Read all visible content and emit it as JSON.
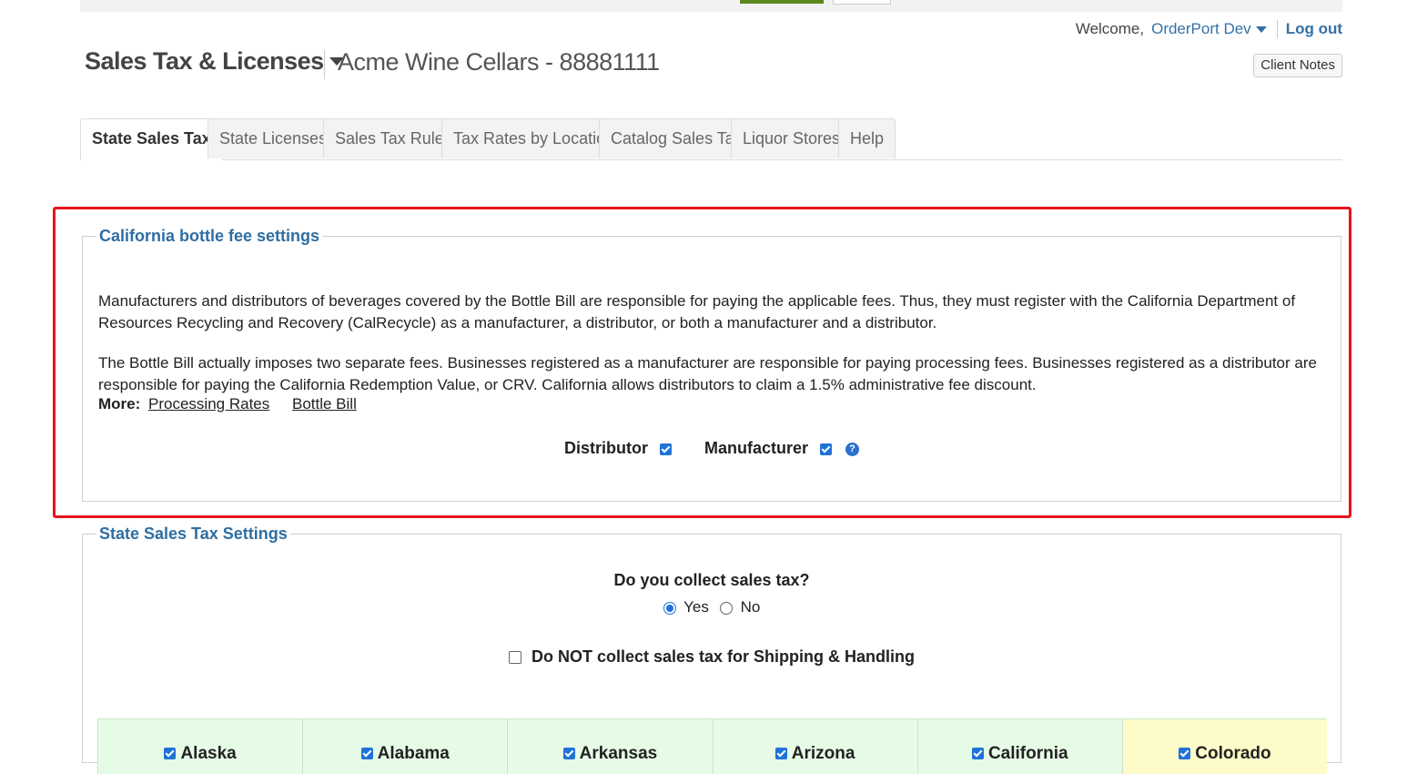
{
  "header": {
    "welcome": "Welcome,",
    "user": "OrderPort Dev",
    "logout": "Log out",
    "client_notes": "Client Notes",
    "section_title": "Sales Tax & Licenses",
    "company": "Acme Wine Cellars - 88881111"
  },
  "tabs": [
    {
      "label": "State Sales Tax",
      "active": true
    },
    {
      "label": "State Licenses"
    },
    {
      "label": "Sales Tax Rules"
    },
    {
      "label": "Tax Rates by Location"
    },
    {
      "label": "Catalog Sales Tax"
    },
    {
      "label": "Liquor Stores"
    },
    {
      "label": "Help"
    }
  ],
  "bottle_fee": {
    "legend": "California bottle fee settings",
    "para1": "Manufacturers and distributors of beverages covered by the Bottle Bill are responsible for paying the applicable fees. Thus, they must register with the California Department of Resources Recycling and Recovery (CalRecycle) as a manufacturer, a distributor, or both a manufacturer and a distributor.",
    "para2": "The Bottle Bill actually imposes two separate fees. Businesses registered as a manufacturer are responsible for paying processing fees. Businesses registered as a distributor are responsible for paying the California Redemption Value, or CRV. California allows distributors to claim a 1.5% administrative fee discount.",
    "more_label": "More:",
    "link1": "Processing Rates",
    "link2": "Bottle Bill",
    "distributor_label": "Distributor",
    "distributor_checked": true,
    "manufacturer_label": "Manufacturer",
    "manufacturer_checked": true
  },
  "sales_tax": {
    "legend": "State Sales Tax Settings",
    "question": "Do you collect sales tax?",
    "yes": "Yes",
    "no": "No",
    "selected": "Yes",
    "shipping_label": "Do NOT collect sales tax for Shipping & Handling",
    "shipping_checked": false,
    "states": [
      {
        "name": "Alaska",
        "checked": true
      },
      {
        "name": "Alabama",
        "checked": true
      },
      {
        "name": "Arkansas",
        "checked": true
      },
      {
        "name": "Arizona",
        "checked": true
      },
      {
        "name": "California",
        "checked": true
      },
      {
        "name": "Colorado",
        "checked": true,
        "highlight": "#fdfbc8"
      }
    ]
  }
}
